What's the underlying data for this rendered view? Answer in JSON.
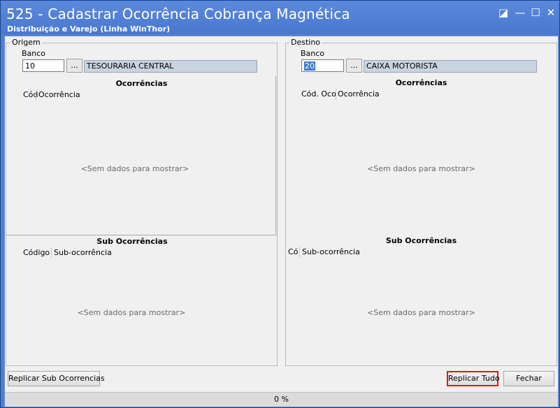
{
  "window": {
    "title": "525 - Cadastrar Ocorrência Cobrança Magnética",
    "subtitle": "Distribuição e Varejo (Linha WinThor)",
    "controls": {
      "restore": "◪",
      "minimize": "—",
      "maximize": "☐",
      "close": "✕"
    }
  },
  "origem": {
    "legend": "Origem",
    "banco_label": "Banco",
    "banco_value": "10",
    "browse_label": "...",
    "banco_nome": "TESOURARIA CENTRAL",
    "ocorrencias": {
      "title": "Ocorrências",
      "col_codigo": "Cód",
      "col_ocorrencia": "Ocorrência",
      "empty": "<Sem dados para mostrar>"
    },
    "sub_ocorrencias": {
      "title": "Sub  Ocorrências",
      "col_codigo": "Código",
      "col_sub": "Sub-ocorrência",
      "empty": "<Sem dados para mostrar>"
    }
  },
  "destino": {
    "legend": "Destino",
    "banco_label": "Banco",
    "banco_value": "20",
    "browse_label": "...",
    "banco_nome": "CAIXA MOTORISTA",
    "ocorrencias": {
      "title": "Ocorrências",
      "col_codigo": "Cód. Oco",
      "col_ocorrencia": "Ocorrência",
      "empty": "<Sem dados para mostrar>"
    },
    "sub_ocorrencias": {
      "title": "Sub  Ocorrências",
      "col_codigo": "Có",
      "col_sub": "Sub-ocorrência",
      "empty": "<Sem dados para mostrar>"
    }
  },
  "footer": {
    "replicar_sub": "Replicar Sub Ocorrencias",
    "replicar_tudo": "Replicar Tudo",
    "fechar": "Fechar",
    "progress": "0 %"
  }
}
